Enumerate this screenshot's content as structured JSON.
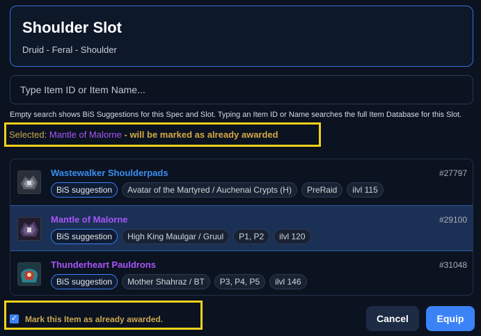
{
  "header": {
    "title": "Shoulder Slot",
    "subtitle": "Druid - Feral - Shoulder"
  },
  "search": {
    "placeholder": "Type Item ID or Item Name...",
    "value": "",
    "hint": "Empty search shows BiS Suggestions for this Spec and Slot. Typing an Item ID or Name searches the full Item Database for this Slot."
  },
  "selection": {
    "label": "Selected:",
    "item_name": "Mantle of Malorne",
    "suffix": " - will be marked as already awarded"
  },
  "items": [
    {
      "name": "Wastewalker Shoulderpads",
      "id": "#27797",
      "name_color": "#3b8ef0",
      "selected": false,
      "tags": [
        "BiS suggestion",
        "Avatar of the Martyred / Auchenai Crypts (H)",
        "PreRaid",
        "ilvl 115"
      ],
      "icon": "wastewalker-shoulderpads-icon"
    },
    {
      "name": "Mantle of Malorne",
      "id": "#29100",
      "name_color": "#a855f7",
      "selected": true,
      "tags": [
        "BiS suggestion",
        "High King Maulgar / Gruul",
        "P1, P2",
        "ilvl 120"
      ],
      "icon": "mantle-of-malorne-icon"
    },
    {
      "name": "Thunderheart Pauldrons",
      "id": "#31048",
      "name_color": "#a855f7",
      "selected": false,
      "tags": [
        "BiS suggestion",
        "Mother Shahraz / BT",
        "P3, P4, P5",
        "ilvl 146"
      ],
      "icon": "thunderheart-pauldrons-icon"
    }
  ],
  "mark_awarded": {
    "checked": true,
    "label": "Mark this Item as already awarded."
  },
  "buttons": {
    "cancel": "Cancel",
    "equip": "Equip"
  },
  "colors": {
    "accent": "#3b82f6",
    "epic": "#a855f7",
    "rare": "#3b8ef0",
    "gold": "#c8a74e",
    "highlight": "#f2d21b"
  }
}
